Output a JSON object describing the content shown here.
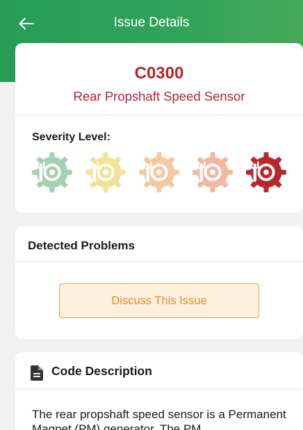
{
  "topbar": {
    "back_icon": "arrow-left-icon",
    "title": "Issue Details"
  },
  "issue": {
    "code": "C0300",
    "name": "Rear Propshaft Speed Sensor",
    "severity_label": "Severity Level:",
    "severity_icon": "wrench-gear-icon",
    "severity_colors": [
      "#a3d1b1",
      "#f1e39a",
      "#f4c9a0",
      "#f3b8a0",
      "#b7272f"
    ],
    "severity_selected_level": 5
  },
  "problems": {
    "title": "Detected Problems",
    "discuss_button": "Discuss This Issue"
  },
  "description": {
    "icon": "document-icon",
    "title": "Code Description",
    "text": "The rear propshaft speed sensor is a Permanent Magnet (PM) generator. The PM"
  },
  "colors": {
    "header_green": "#2fa35a",
    "code_red": "#b5252c",
    "button_border": "#f0a24a",
    "button_text": "#ec8c2b",
    "button_fill": "#fdf0dc"
  }
}
